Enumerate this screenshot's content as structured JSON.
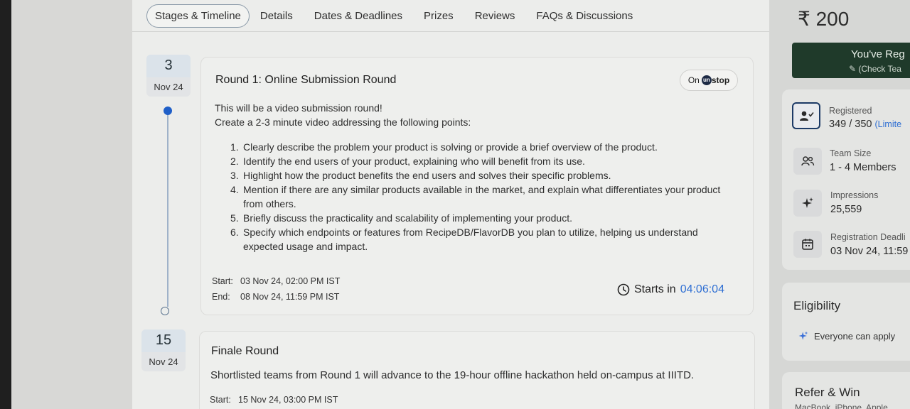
{
  "tabs": [
    {
      "label": "Stages & Timeline"
    },
    {
      "label": "Details"
    },
    {
      "label": "Dates & Deadlines"
    },
    {
      "label": "Prizes"
    },
    {
      "label": "Reviews"
    },
    {
      "label": "FAQs & Discussions"
    }
  ],
  "round1": {
    "date_day": "3",
    "date_month": "Nov 24",
    "title": "Round 1: Online Submission Round",
    "platform_prefix": "On",
    "platform_logo": "un",
    "platform_name": "stop",
    "desc_line1": "This will be a video submission round!",
    "desc_line2": "Create a 2-3 minute video addressing the following points:",
    "points": [
      {
        "num": "1.",
        "text": "Clearly describe the problem your product is solving or provide a brief overview of the product."
      },
      {
        "num": "2.",
        "text": "Identify the end users of your product, explaining who will benefit from its use."
      },
      {
        "num": "3.",
        "text": "Highlight how the product benefits the end users and solves their specific problems."
      },
      {
        "num": "4.",
        "text": "Mention if there are any similar products available in the market, and explain what differentiates your product from others."
      },
      {
        "num": "5.",
        "text": "Briefly discuss the practicality and scalability of implementing your product."
      },
      {
        "num": "6.",
        "text": "Specify which endpoints or features from RecipeDB/FlavorDB you plan to utilize, helping us understand expected usage and impact."
      }
    ],
    "start_label": "Start:",
    "start_value": "03 Nov 24, 02:00 PM IST",
    "end_label": "End:",
    "end_value": "08 Nov 24, 11:59 PM IST",
    "starts_in_label": "Starts in",
    "countdown": "04:06:04"
  },
  "finale": {
    "date_day": "15",
    "date_month": "Nov 24",
    "title": "Finale Round",
    "desc": "Shortlisted teams from Round 1 will advance to the 19-hour offline hackathon held on-campus at IIITD.",
    "start_label": "Start:",
    "start_value": "15 Nov 24, 03:00 PM IST"
  },
  "sidebar": {
    "price": "₹ 200",
    "registered_button_line1": "You've Reg",
    "registered_button_line2": "✎ (Check Tea",
    "info": [
      {
        "icon": "user-check-icon",
        "label": "Registered",
        "value": "349 / 350",
        "extra": "(Limite"
      },
      {
        "icon": "team-icon",
        "label": "Team Size",
        "value": "1 - 4 Members"
      },
      {
        "icon": "sparkle-icon",
        "label": "Impressions",
        "value": "25,559"
      },
      {
        "icon": "calendar-icon",
        "label": "Registration Deadli",
        "value": "03 Nov 24, 11:59"
      }
    ],
    "eligibility_title": "Eligibility",
    "eligibility_text": "Everyone can apply",
    "refer_title": "Refer & Win",
    "refer_sub": "MacBook, iPhone, Apple"
  },
  "colors": {
    "accent_blue": "#2f6fd3",
    "timeline_dot": "#1f5fc8",
    "register_green": "#1f3a2a"
  }
}
